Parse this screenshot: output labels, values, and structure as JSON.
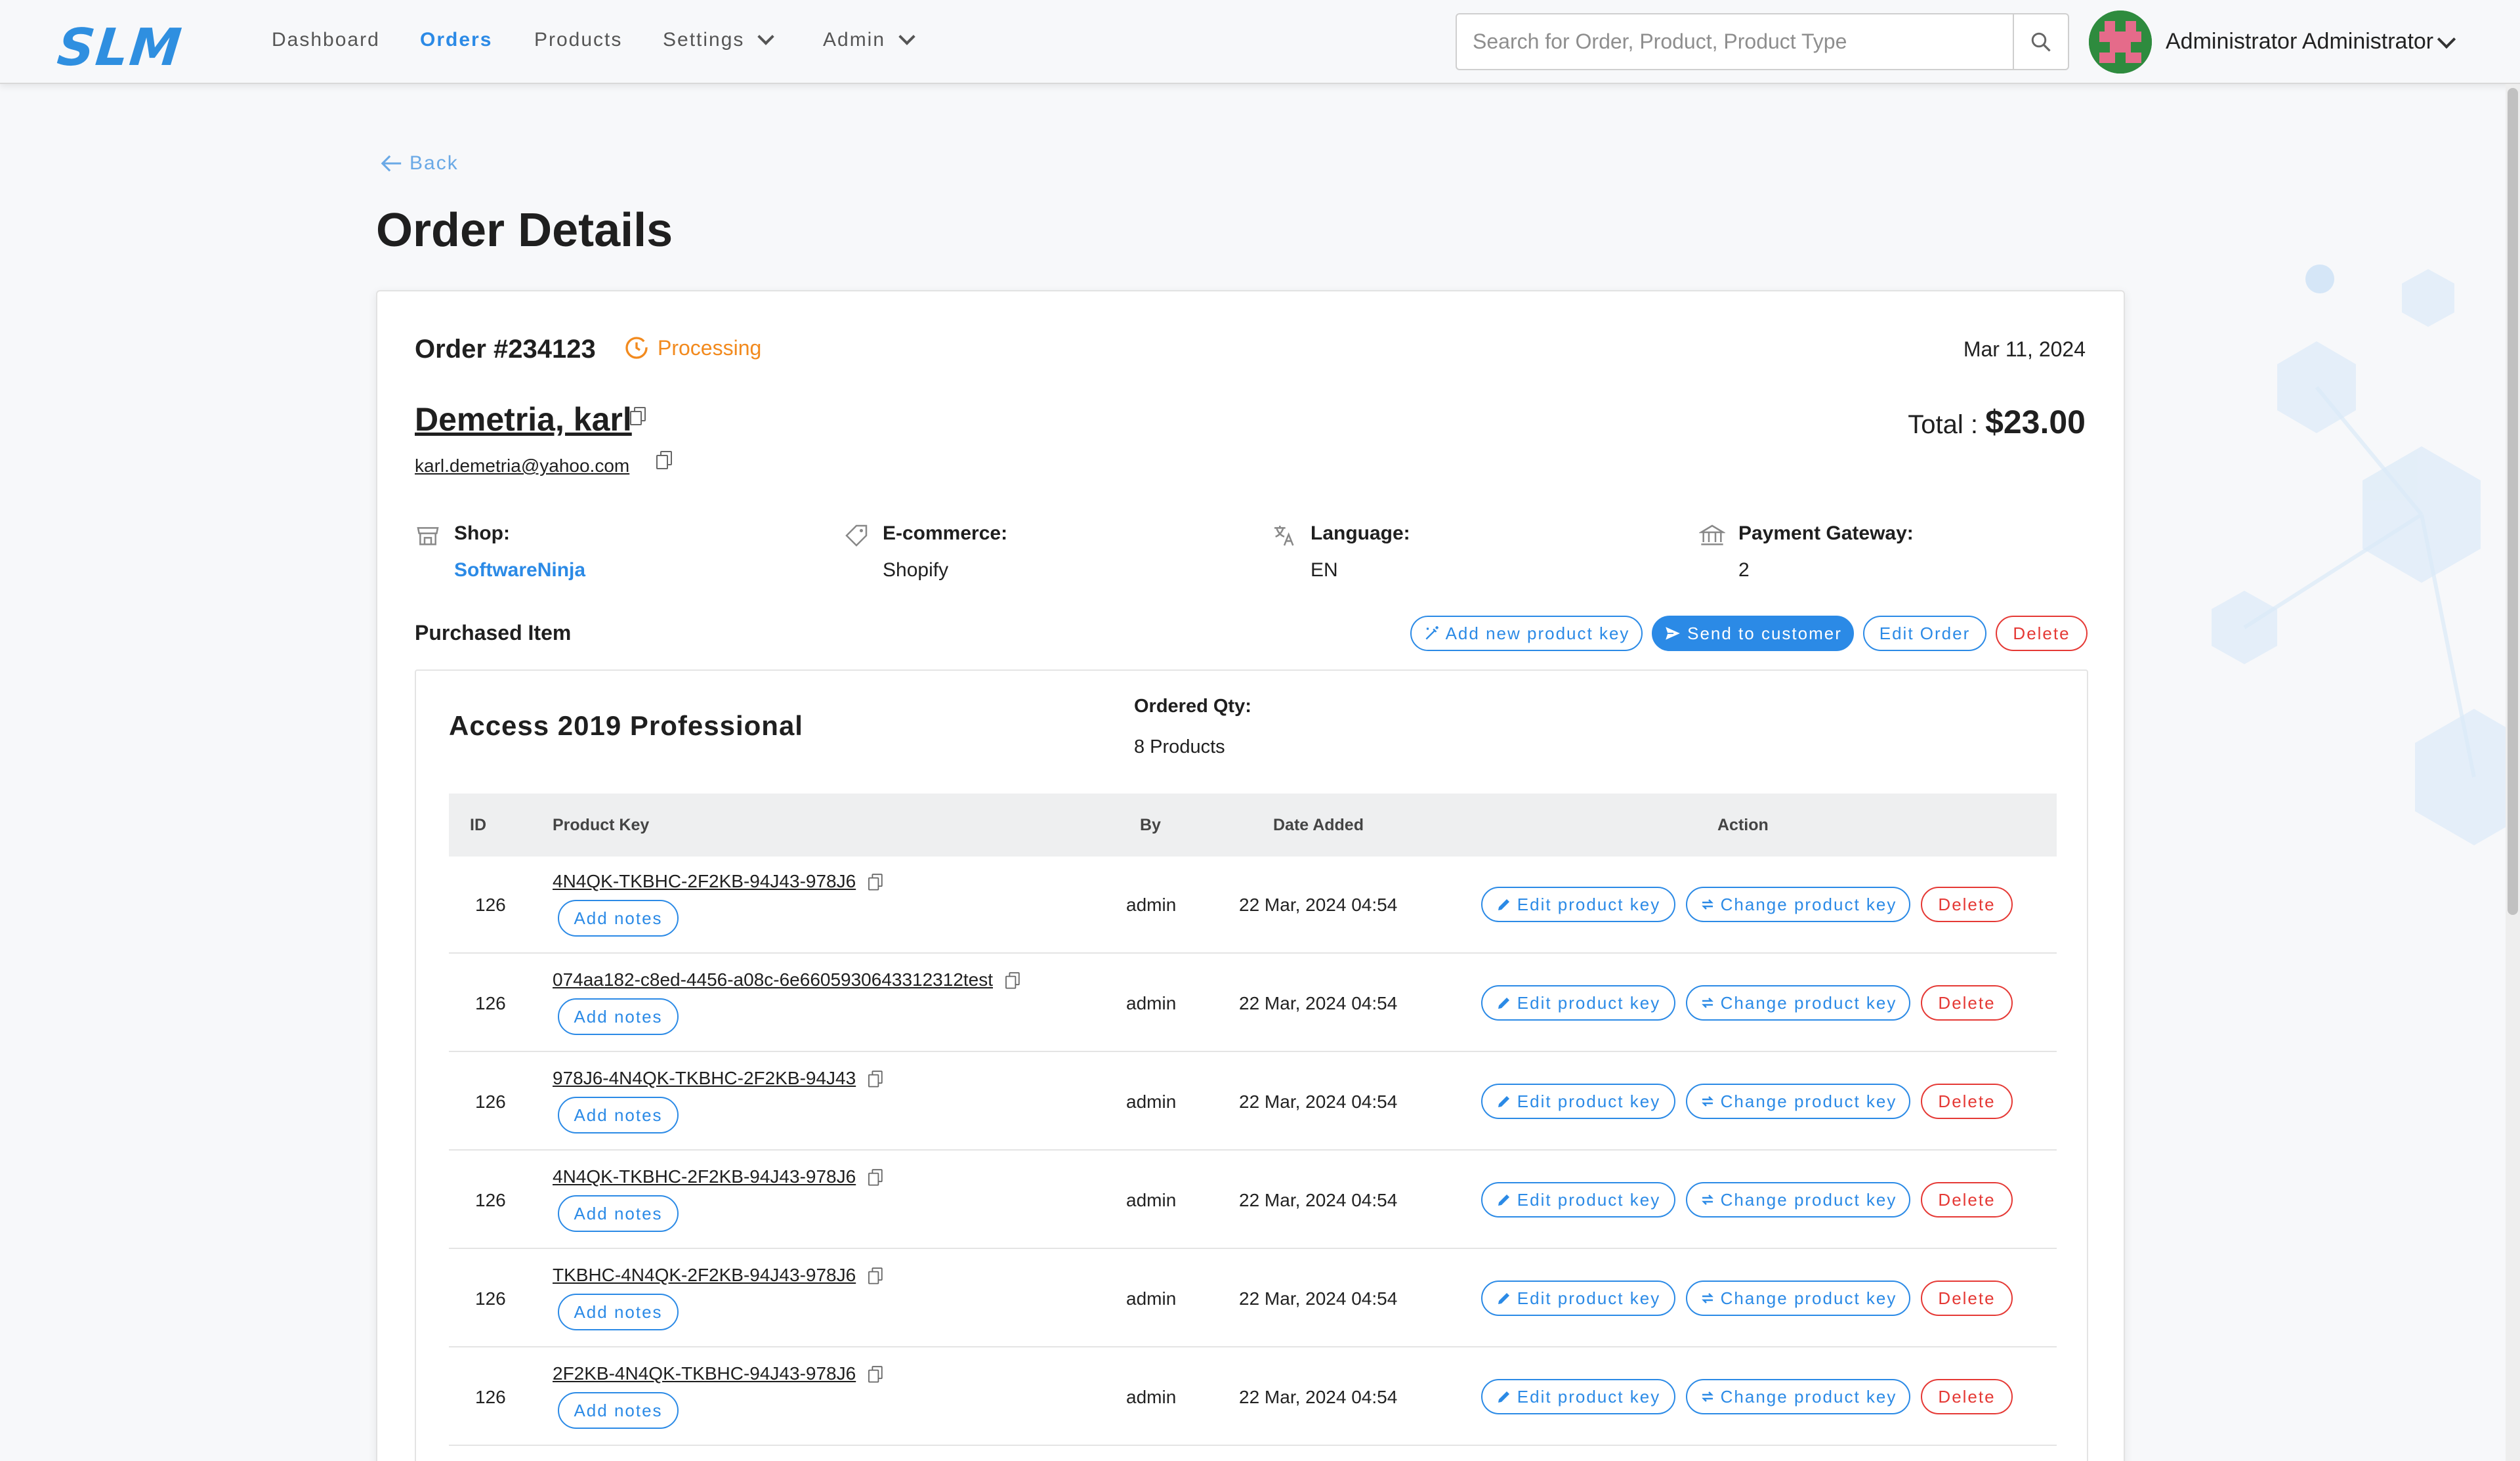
{
  "app": {
    "logo": "SLM",
    "nav": [
      "Dashboard",
      "Orders",
      "Products",
      "Settings",
      "Admin"
    ],
    "search_placeholder": "Search for Order, Product, Product Type",
    "user": "Administrator Administrator"
  },
  "page": {
    "back": "Back",
    "title": "Order Details"
  },
  "order": {
    "number": "Order #234123",
    "status": "Processing",
    "date": "Mar 11, 2024",
    "customer": "Demetria, karl",
    "email": "karl.demetria@yahoo.com",
    "total_label": "Total : ",
    "total_value": "$23.00",
    "shop_label": "Shop:",
    "shop_value": "SoftwareNinja",
    "ecommerce_label": "E-commerce:",
    "ecommerce_value": "Shopify",
    "language_label": "Language:",
    "language_value": "EN",
    "gateway_label": "Payment Gateway:",
    "gateway_value": "2"
  },
  "purchased": {
    "title": "Purchased Item",
    "add_key": "Add new product key",
    "send": "Send to customer",
    "edit_order": "Edit Order",
    "delete": "Delete"
  },
  "item": {
    "name": "Access 2019 Professional",
    "qty_label": "Ordered Qty:",
    "qty_value": "8 Products"
  },
  "table": {
    "headers": {
      "id": "ID",
      "key": "Product Key",
      "by": "By",
      "date": "Date Added",
      "action": "Action"
    },
    "add_notes": "Add notes",
    "edit_key": "Edit product key",
    "change_key": "Change product key",
    "delete": "Delete",
    "rows": [
      {
        "id": "126",
        "key": "4N4QK-TKBHC-2F2KB-94J43-978J6",
        "by": "admin",
        "date": "22 Mar, 2024 04:54"
      },
      {
        "id": "126",
        "key": "074aa182-c8ed-4456-a08c-6e6605930643312312test",
        "by": "admin",
        "date": "22 Mar, 2024 04:54"
      },
      {
        "id": "126",
        "key": "978J6-4N4QK-TKBHC-2F2KB-94J43",
        "by": "admin",
        "date": "22 Mar, 2024 04:54"
      },
      {
        "id": "126",
        "key": "4N4QK-TKBHC-2F2KB-94J43-978J6",
        "by": "admin",
        "date": "22 Mar, 2024 04:54"
      },
      {
        "id": "126",
        "key": "TKBHC-4N4QK-2F2KB-94J43-978J6",
        "by": "admin",
        "date": "22 Mar, 2024 04:54"
      },
      {
        "id": "126",
        "key": "2F2KB-4N4QK-TKBHC-94J43-978J6",
        "by": "admin",
        "date": "22 Mar, 2024 04:54"
      }
    ]
  },
  "colors": {
    "accent": "#2b8ae6",
    "status": "#f28a1e",
    "danger": "#e53935"
  }
}
